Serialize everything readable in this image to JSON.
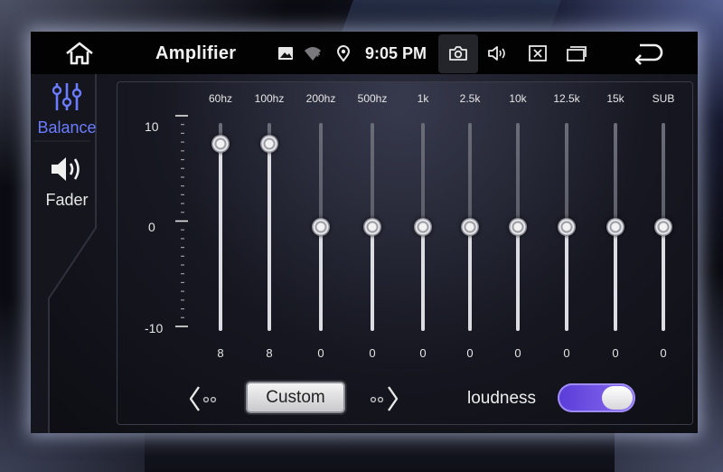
{
  "status_bar": {
    "title": "Amplifier",
    "time": "9:05 PM",
    "icons": [
      "home-icon",
      "gallery-icon",
      "wifi-icon",
      "location-icon",
      "camera-icon",
      "volume-icon",
      "close-box-icon",
      "recent-apps-icon",
      "back-icon"
    ]
  },
  "sidebar": {
    "items": [
      {
        "label": "Balance",
        "icon": "equalizer-icon",
        "active": true
      },
      {
        "label": "Fader",
        "icon": "speaker-icon",
        "active": false
      }
    ]
  },
  "eq": {
    "scale": {
      "max": "10",
      "mid": "0",
      "min": "-10"
    },
    "range": [
      -10,
      10
    ],
    "bands": [
      {
        "label": "60hz",
        "value": 8,
        "value_text": "8"
      },
      {
        "label": "100hz",
        "value": 8,
        "value_text": "8"
      },
      {
        "label": "200hz",
        "value": 0,
        "value_text": "0"
      },
      {
        "label": "500hz",
        "value": 0,
        "value_text": "0"
      },
      {
        "label": "1k",
        "value": 0,
        "value_text": "0"
      },
      {
        "label": "2.5k",
        "value": 0,
        "value_text": "0"
      },
      {
        "label": "10k",
        "value": 0,
        "value_text": "0"
      },
      {
        "label": "12.5k",
        "value": 0,
        "value_text": "0"
      },
      {
        "label": "15k",
        "value": 0,
        "value_text": "0"
      },
      {
        "label": "SUB",
        "value": 0,
        "value_text": "0"
      }
    ],
    "preset": "Custom",
    "loudness_label": "loudness",
    "loudness_on": true
  },
  "colors": {
    "accent": "#6b7cff",
    "toggle_on": "#7a5ce8"
  }
}
